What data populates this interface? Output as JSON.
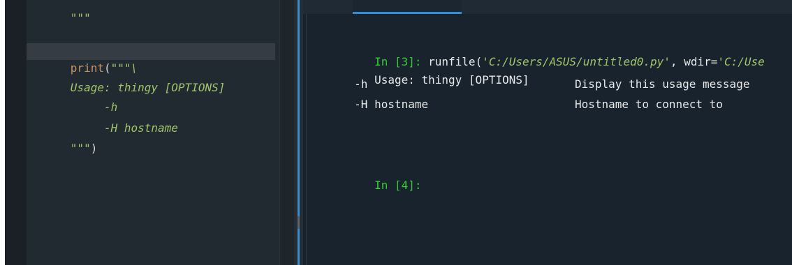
{
  "editor": {
    "lines": [
      {
        "text": "\"\"\""
      },
      {
        "print_kw": "print",
        "open": "(",
        "string": "\"\"\"\\"
      },
      {
        "text": "Usage: thingy [OPTIONS]"
      },
      {
        "text": "     -h"
      },
      {
        "text": "     -H hostname"
      },
      {
        "string": "\"\"\"",
        "close": ")"
      }
    ]
  },
  "console": {
    "prompt3": "In [3]:",
    "runfile_call": " runfile(",
    "runfile_path": "'C:/Users/ASUS/untitled0.py'",
    "wdir_label": ", wdir=",
    "wdir_value": "'C:/Use",
    "usage_line": "Usage: thingy [OPTIONS]",
    "options": [
      {
        "flag": "     -h",
        "desc": "Display this usage message"
      },
      {
        "flag": "     -H hostname",
        "desc": "Hostname to connect to"
      }
    ],
    "prompt4": "In [4]:"
  },
  "colors": {
    "editor_bg": "#222a31",
    "console_bg": "#19232d",
    "prompt_green": "#33cc33",
    "string_green": "#9fc46b",
    "print_keyword": "#c39464",
    "accent_blue": "#2f8fd8"
  }
}
